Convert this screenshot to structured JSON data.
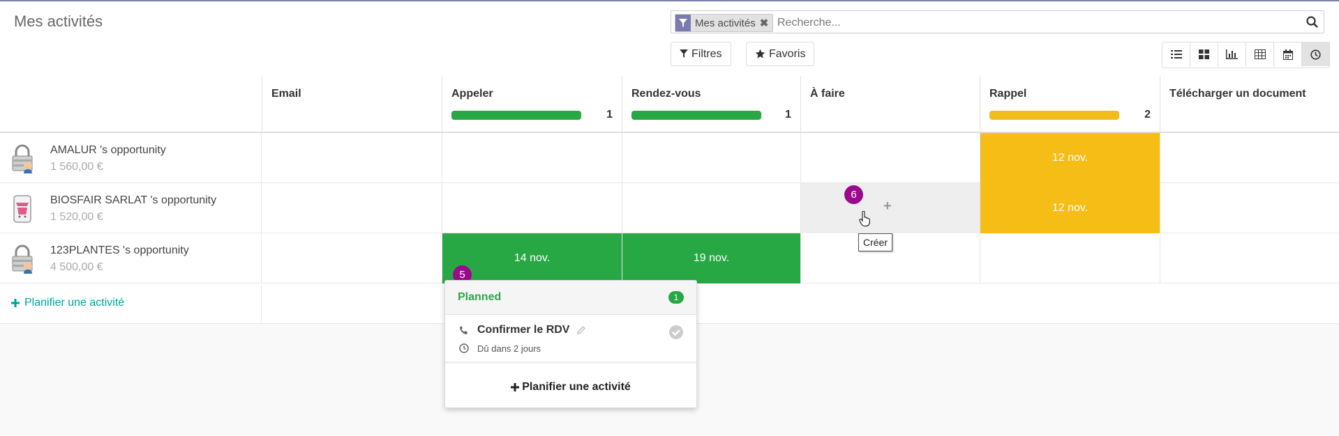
{
  "page": {
    "title": "Mes activités"
  },
  "search": {
    "facet_label": "Mes activités",
    "facet_icon": "filter-icon",
    "placeholder": "Recherche..."
  },
  "buttons": {
    "filters": "Filtres",
    "favorites": "Favoris"
  },
  "views": [
    "list-view-icon",
    "kanban-view-icon",
    "graph-view-icon",
    "pivot-view-icon",
    "calendar-view-icon",
    "activity-view-icon"
  ],
  "columns": [
    {
      "name": "Email",
      "count": "",
      "bar_color": ""
    },
    {
      "name": "Appeler",
      "count": "1",
      "bar_color": "#28a745"
    },
    {
      "name": "Rendez-vous",
      "count": "1",
      "bar_color": "#28a745"
    },
    {
      "name": "À faire",
      "count": "",
      "bar_color": ""
    },
    {
      "name": "Rappel",
      "count": "2",
      "bar_color": "#f0bd1a"
    },
    {
      "name": "Télécharger un document",
      "count": "",
      "bar_color": ""
    }
  ],
  "records": [
    {
      "name": "AMALUR 's opportunity",
      "amount": "1 560,00 €",
      "cells": [
        "",
        "",
        "",
        "",
        "12 nov.",
        ""
      ]
    },
    {
      "name": "BIOSFAIR SARLAT 's opportunity",
      "amount": "1 520,00 €",
      "cells": [
        "",
        "",
        "",
        "",
        "12 nov.",
        ""
      ]
    },
    {
      "name": "123PLANTES 's opportunity",
      "amount": "4 500,00 €",
      "cells": [
        "",
        "14 nov.",
        "19 nov.",
        "",
        "",
        ""
      ]
    }
  ],
  "schedule_label": "Planifier une activité",
  "colors": {
    "planned": "#28a745",
    "today": "#f5bd15",
    "brand": "#7c7bad",
    "link": "#00a09d",
    "badge": "#9b0a8c"
  },
  "badges": {
    "popover": "5",
    "cell": "6"
  },
  "popover": {
    "header": "Planned",
    "count": "1",
    "activity": "Confirmer le RDV",
    "due": "Dû dans 2 jours",
    "footer": "Planifier une activité"
  },
  "tooltip": "Créer"
}
